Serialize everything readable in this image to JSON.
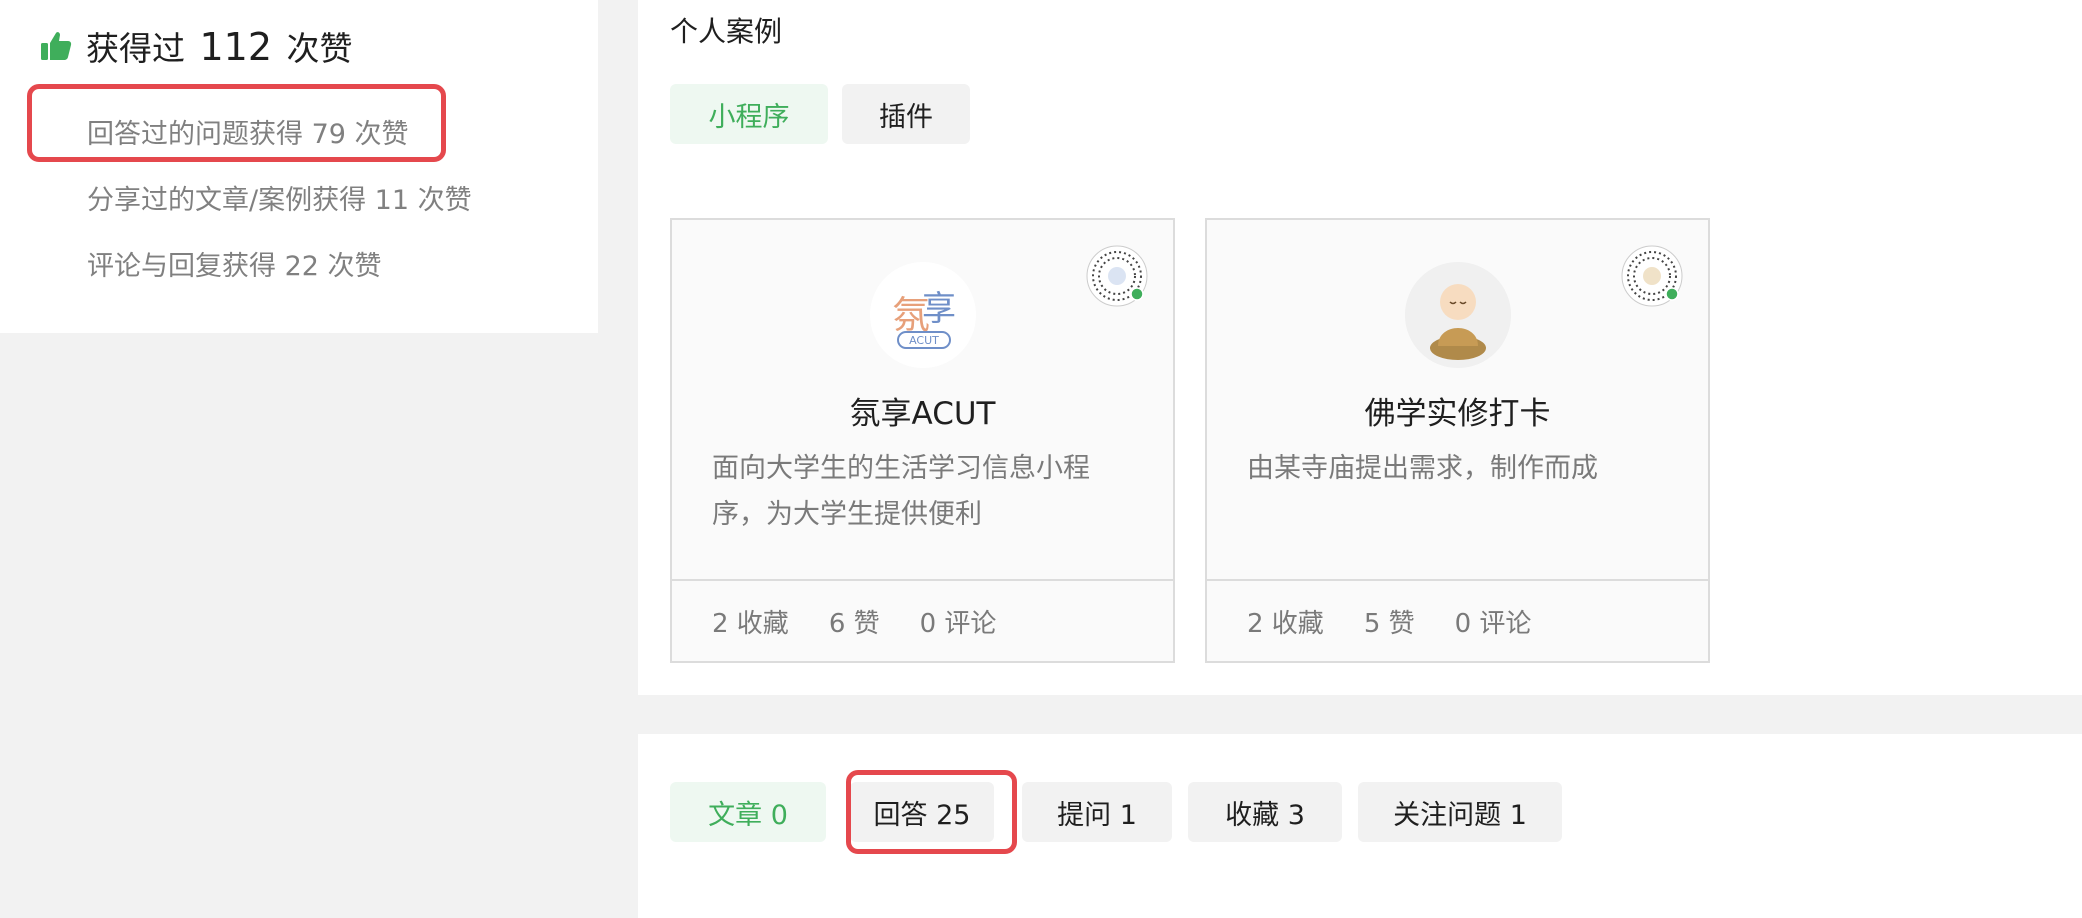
{
  "likes": {
    "prefix": "获得过",
    "total": "112",
    "suffix": "次赞",
    "items": [
      "回答过的问题获得 79 次赞",
      "分享过的文章/案例获得 11 次赞",
      "评论与回复获得 22 次赞"
    ]
  },
  "cases": {
    "title": "个人案例",
    "filters": [
      "小程序",
      "插件"
    ],
    "cards": [
      {
        "name": "氛享ACUT",
        "description": "面向大学生的生活学习信息小程序，为大学生提供便利",
        "favorites": "2 收藏",
        "likes": "6 赞",
        "comments": "0 评论"
      },
      {
        "name": "佛学实修打卡",
        "description": "由某寺庙提出需求，制作而成",
        "favorites": "2 收藏",
        "likes": "5 赞",
        "comments": "0 评论"
      }
    ]
  },
  "tabs": [
    "文章 0",
    "回答 25",
    "提问 1",
    "收藏 3",
    "关注问题 1"
  ],
  "colors": {
    "accent_green": "#3fae5b",
    "highlight_red": "#e5484d"
  },
  "icons": {
    "likes": "thumbs-up-icon",
    "card_qr": "mini-program-qr-code-icon"
  }
}
